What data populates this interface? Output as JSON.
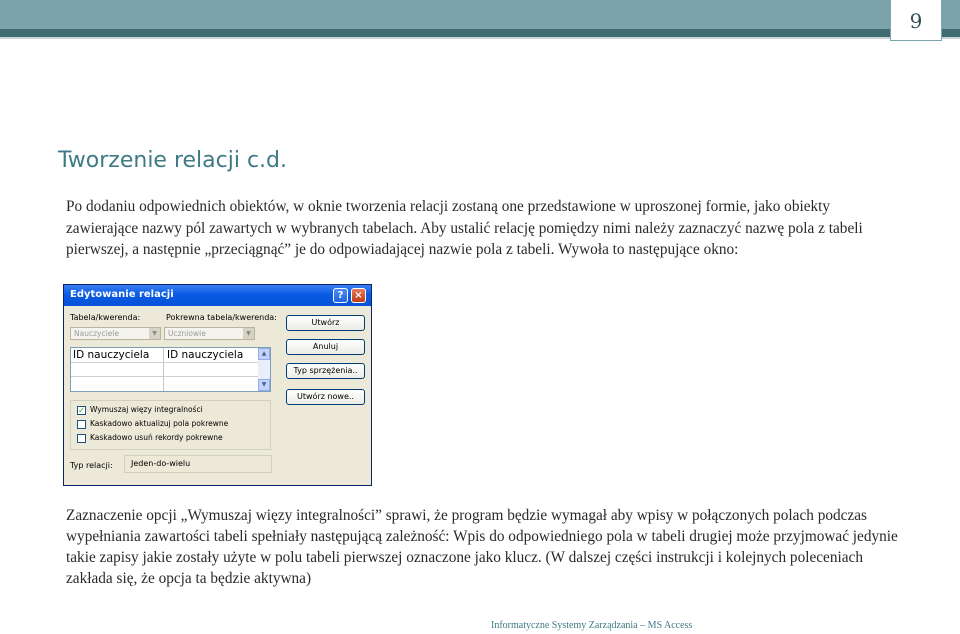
{
  "page_number": "9",
  "title": "Tworzenie relacji c.d.",
  "paragraph_1": "Po dodaniu odpowiednich obiektów, w oknie tworzenia relacji zostaną one przedstawione w uproszonej formie, jako obiekty zawierające nazwy pól zawartych w wybranych tabelach. Aby ustalić relację pomiędzy nimi należy zaznaczyć nazwę pola z tabeli pierwszej, a następnie „przeciągnąć” je do odpowiadającej nazwie pola z tabeli. Wywoła to następujące okno:",
  "paragraph_2": "Zaznaczenie opcji „Wymuszaj więzy integralności” sprawi, że program będzie wymagał aby wpisy w połączonych polach podczas wypełniania zawartości tabeli spełniały następującą zależność: Wpis do odpowiedniego pola w tabeli drugiej może przyjmować jedynie takie zapisy jakie zostały użyte w polu tabeli pierwszej oznaczone jako klucz. (W dalszej części instrukcji i kolejnych poleceniach zakłada się, że opcja ta będzie aktywna)",
  "footer": "Informatyczne Systemy Zarządzania – MS Access",
  "dialog": {
    "title": "Edytowanie relacji",
    "help_glyph": "?",
    "close_glyph": "×",
    "table_label": "Tabela/kwerenda:",
    "related_label": "Pokrewna tabela/kwerenda:",
    "table_value": "Nauczyciele",
    "related_value": "Uczniowie",
    "grid_left": "ID nauczyciela",
    "grid_right": "ID nauczyciela",
    "buttons": {
      "create": "Utwórz",
      "cancel": "Anuluj",
      "join_type": "Typ sprzężenia..",
      "new": "Utwórz nowe.."
    },
    "options": [
      {
        "label": "Wymuszaj więzy integralności",
        "checked": true
      },
      {
        "label": "Kaskadowo aktualizuj pola pokrewne",
        "checked": false
      },
      {
        "label": "Kaskadowo usuń rekordy pokrewne",
        "checked": false
      }
    ],
    "relation_type_label": "Typ relacji:",
    "relation_type_value": "Jeden-do-wielu"
  }
}
